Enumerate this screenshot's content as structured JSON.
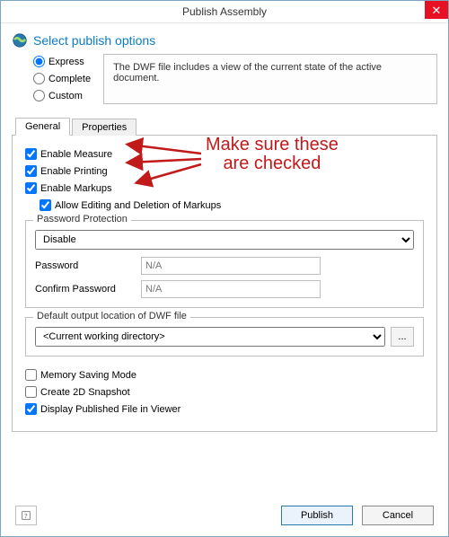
{
  "window": {
    "title": "Publish Assembly",
    "close_glyph": "✕"
  },
  "header": {
    "title": "Select publish options"
  },
  "radios": {
    "express": "Express",
    "complete": "Complete",
    "custom": "Custom"
  },
  "description": "The DWF file includes a view of the current state of the active document.",
  "tabs": {
    "general": "General",
    "properties": "Properties"
  },
  "checks": {
    "enable_measure": "Enable Measure",
    "enable_printing": "Enable Printing",
    "enable_markups": "Enable Markups",
    "allow_edit_markups": "Allow Editing and Deletion of Markups"
  },
  "password_section": {
    "legend": "Password Protection",
    "disable_option": "Disable",
    "password_label": "Password",
    "confirm_label": "Confirm Password",
    "na_placeholder": "N/A"
  },
  "output_section": {
    "legend": "Default output location of DWF file",
    "option": "<Current working directory>",
    "browse": "..."
  },
  "bottom": {
    "memory_saving": "Memory Saving Mode",
    "create_snapshot": "Create 2D Snapshot",
    "display_in_viewer": "Display Published File in Viewer"
  },
  "buttons": {
    "publish": "Publish",
    "cancel": "Cancel",
    "help_glyph": "?"
  },
  "annotation": {
    "text": "Make sure these\nare checked"
  },
  "colors": {
    "accent": "#0b7cc1",
    "annotation": "#c11a1a",
    "close_bg": "#e81123"
  }
}
